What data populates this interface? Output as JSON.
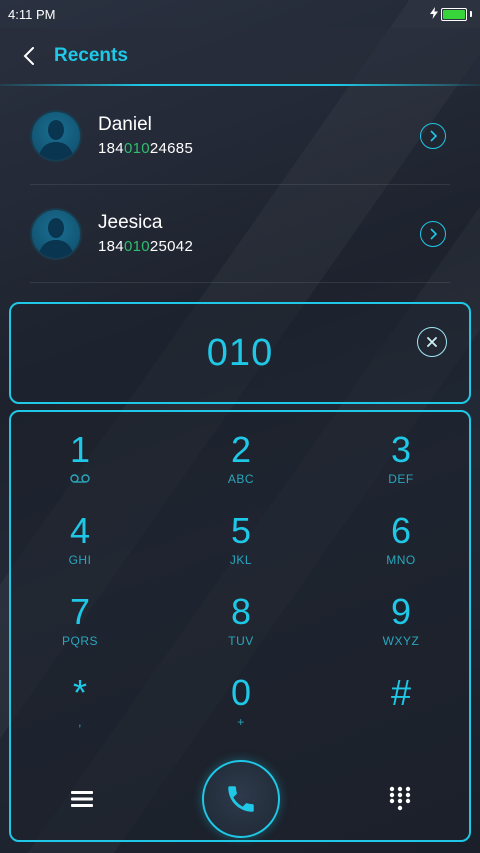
{
  "status_bar": {
    "time": "4:11 PM"
  },
  "header": {
    "title": "Recents"
  },
  "contacts": [
    {
      "name": "Daniel",
      "number_prefix": "184",
      "number_match": "010",
      "number_suffix": "24685"
    },
    {
      "name": "Jeesica",
      "number_prefix": "184",
      "number_match": "010",
      "number_suffix": "25042"
    }
  ],
  "dial_input": {
    "value": "010"
  },
  "keypad": [
    {
      "digit": "1",
      "letters": ""
    },
    {
      "digit": "2",
      "letters": "ABC"
    },
    {
      "digit": "3",
      "letters": "DEF"
    },
    {
      "digit": "4",
      "letters": "GHI"
    },
    {
      "digit": "5",
      "letters": "JKL"
    },
    {
      "digit": "6",
      "letters": "MNO"
    },
    {
      "digit": "7",
      "letters": "PQRS"
    },
    {
      "digit": "8",
      "letters": "TUV"
    },
    {
      "digit": "9",
      "letters": "WXYZ"
    },
    {
      "digit": "*",
      "letters": ","
    },
    {
      "digit": "0",
      "letters": "+"
    },
    {
      "digit": "#",
      "letters": ""
    }
  ],
  "colors": {
    "accent": "#1ec8e6",
    "match_highlight": "#2fbf6f",
    "battery": "#37d53a"
  }
}
